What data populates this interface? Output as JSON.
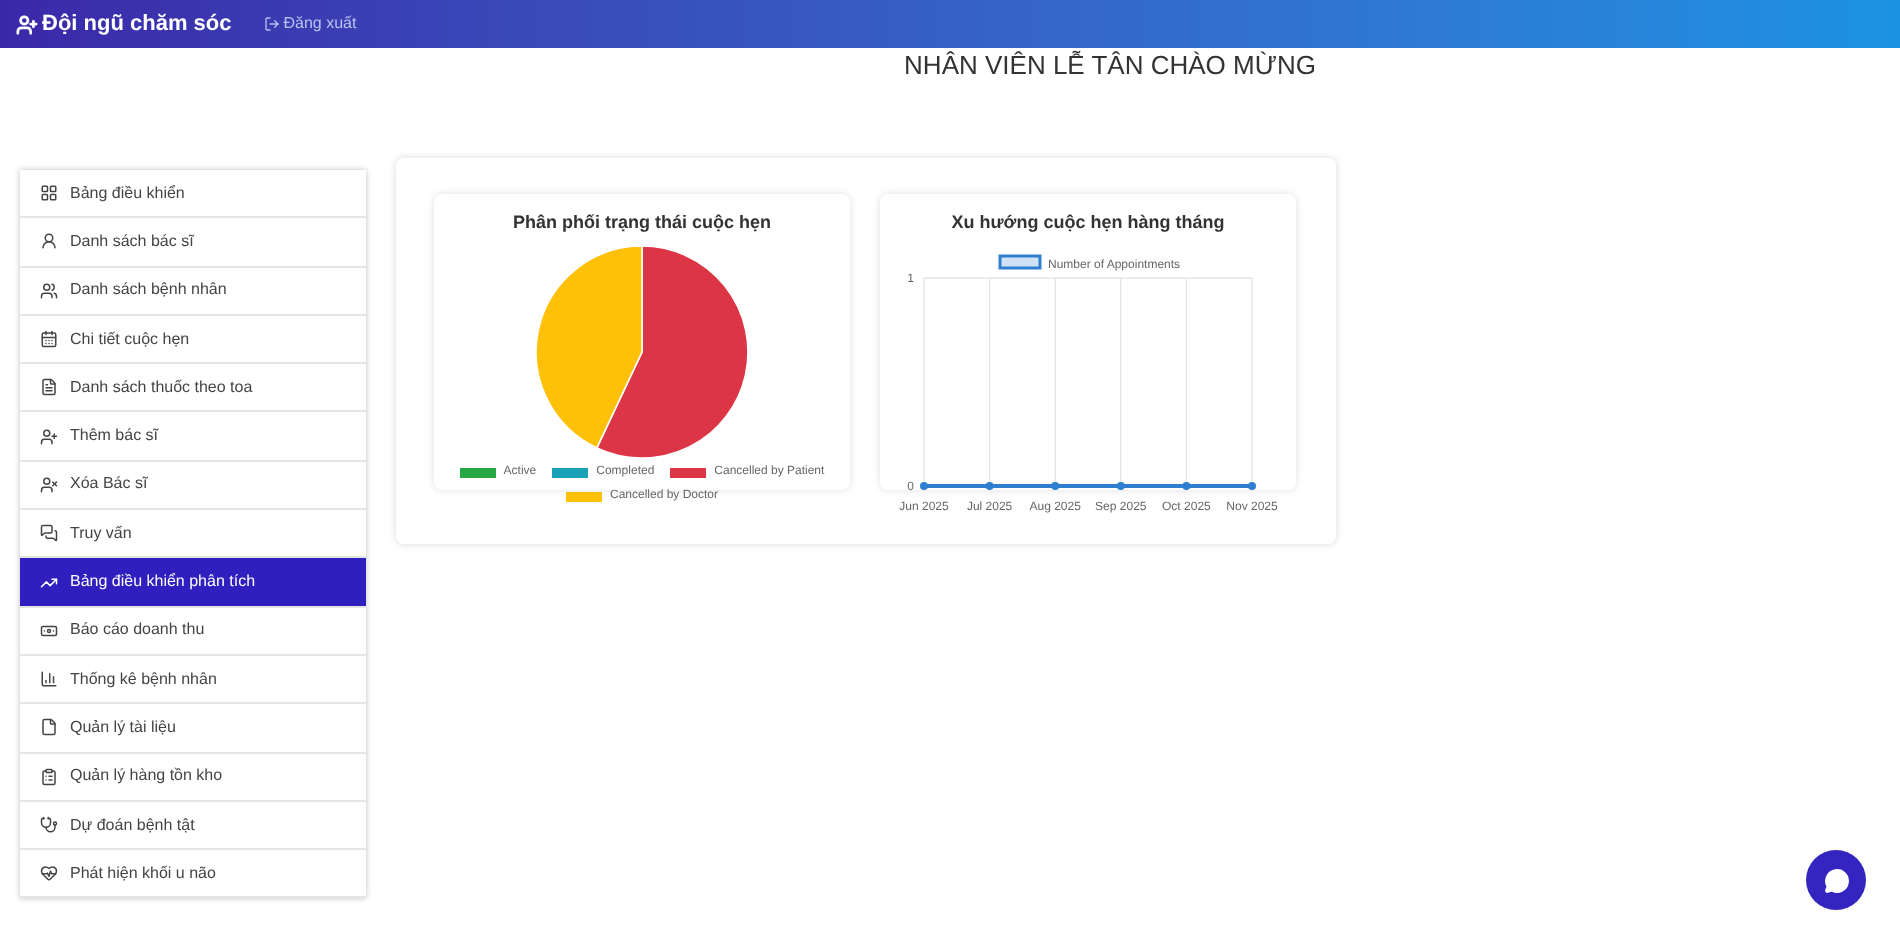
{
  "header": {
    "brand": "Đội ngũ chăm sóc",
    "logout": "Đăng xuất"
  },
  "heading": "NHÂN VIÊN LỄ TÂN CHÀO MỪNG",
  "sidebar": {
    "items": [
      {
        "label": "Bảng điều khiển",
        "selected": false
      },
      {
        "label": "Danh sách bác sĩ",
        "selected": false
      },
      {
        "label": "Danh sách bệnh nhân",
        "selected": false
      },
      {
        "label": "Chi tiết cuộc hẹn",
        "selected": false
      },
      {
        "label": "Danh sách thuốc theo toa",
        "selected": false
      },
      {
        "label": "Thêm bác sĩ",
        "selected": false
      },
      {
        "label": "Xóa Bác sĩ",
        "selected": false
      },
      {
        "label": "Truy vấn",
        "selected": false
      },
      {
        "label": "Bảng điều khiển phân tích",
        "selected": true
      },
      {
        "label": "Báo cáo doanh thu",
        "selected": false
      },
      {
        "label": "Thống kê bệnh nhân",
        "selected": false
      },
      {
        "label": "Quản lý tài liệu",
        "selected": false
      },
      {
        "label": "Quản lý hàng tồn kho",
        "selected": false
      },
      {
        "label": "Dự đoán bệnh tật",
        "selected": false
      },
      {
        "label": "Phát hiện khối u não",
        "selected": false
      }
    ]
  },
  "charts": [
    {
      "title": "Phân phối trạng thái cuộc hẹn",
      "chart_data": {
        "type": "pie",
        "legend": "bottom",
        "categories": [
          "Active",
          "Completed",
          "Cancelled by Patient",
          "Cancelled by Doctor"
        ],
        "values": [
          0,
          0,
          57,
          43
        ],
        "colors": [
          "#28a745",
          "#17a2b8",
          "#dc3545",
          "#ffc107"
        ]
      }
    },
    {
      "title": "Xu hướng cuộc hẹn hàng tháng",
      "chart_data": {
        "type": "line",
        "legend": "top",
        "grid": true,
        "categories": [
          "Jun 2025",
          "Jul 2025",
          "Aug 2025",
          "Sep 2025",
          "Oct 2025",
          "Nov 2025"
        ],
        "series": [
          {
            "name": "Number of Appointments",
            "color": "#2f7fd0",
            "marker": true,
            "values": [
              0,
              0,
              0,
              0,
              0,
              0
            ]
          }
        ],
        "ylim": [
          0,
          1
        ],
        "yticks": [
          0,
          1
        ]
      }
    }
  ]
}
